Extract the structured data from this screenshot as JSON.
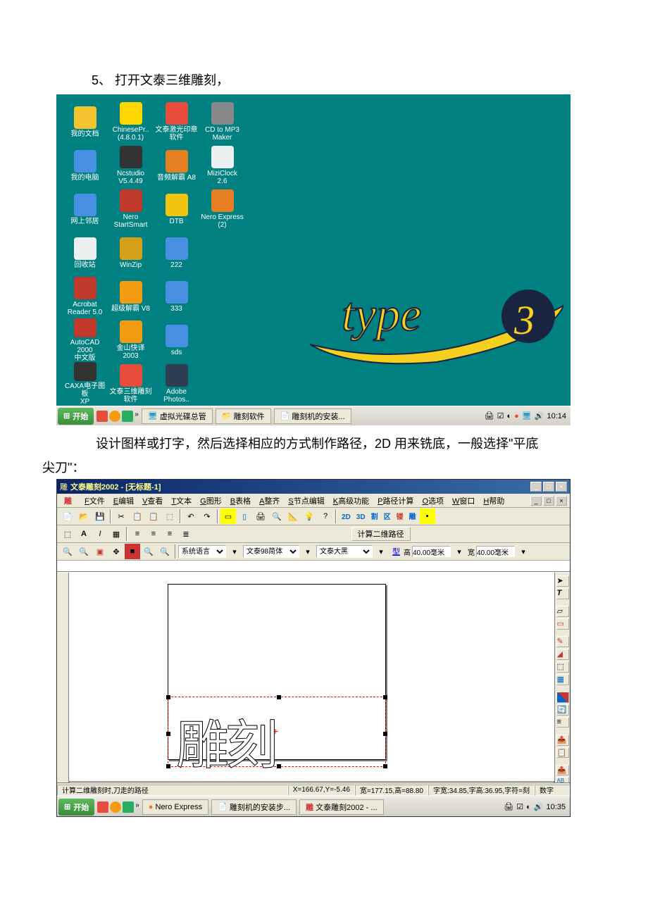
{
  "doc": {
    "step": "5、 打开文泰三维雕刻，",
    "body1": "设计图样或打字，然后选择相应的方式制作路径，2D 用来铣底，一般选择\"平底",
    "body2": "尖刀\"："
  },
  "desktop": {
    "icons": [
      {
        "label": "我的文档",
        "color": "#f4c430"
      },
      {
        "label": "ChinesePr..\n(4.8.0.1)",
        "color": "#ffd700"
      },
      {
        "label": "文泰激光印章\n软件",
        "color": "#e74c3c"
      },
      {
        "label": "CD to MP3\nMaker",
        "color": "#888"
      },
      {
        "label": "",
        "color": "transparent"
      },
      {
        "label": "我的电脑",
        "color": "#4a90e2"
      },
      {
        "label": "Ncstudio\nV5.4.49",
        "color": "#333"
      },
      {
        "label": "音频解霸 A8",
        "color": "#e67e22"
      },
      {
        "label": "MiziClock\n2.6",
        "color": "#ecf0f1"
      },
      {
        "label": "",
        "color": "transparent"
      },
      {
        "label": "网上邻居",
        "color": "#4a90e2"
      },
      {
        "label": "Nero\nStartSmart",
        "color": "#c0392b"
      },
      {
        "label": "DTB",
        "color": "#f1c40f"
      },
      {
        "label": "Nero Express\n(2)",
        "color": "#e67e22"
      },
      {
        "label": "",
        "color": "transparent"
      },
      {
        "label": "回收站",
        "color": "#ecf0f1"
      },
      {
        "label": "WinZip",
        "color": "#d4a017"
      },
      {
        "label": "222",
        "color": "#4a90e2"
      },
      {
        "label": "",
        "color": "transparent"
      },
      {
        "label": "",
        "color": "transparent"
      },
      {
        "label": "Acrobat\nReader 5.0",
        "color": "#c0392b"
      },
      {
        "label": "超级解霸 V8",
        "color": "#f39c12"
      },
      {
        "label": "333",
        "color": "#4a90e2"
      },
      {
        "label": "",
        "color": "transparent"
      },
      {
        "label": "",
        "color": "transparent"
      },
      {
        "label": "AutoCAD 2000\n中文版",
        "color": "#c0392b"
      },
      {
        "label": "金山快译\n2003",
        "color": "#f39c12"
      },
      {
        "label": "sds",
        "color": "#4a90e2"
      },
      {
        "label": "",
        "color": "transparent"
      },
      {
        "label": "",
        "color": "transparent"
      },
      {
        "label": "CAXA电子图板\nXP",
        "color": "#333"
      },
      {
        "label": "文泰三维雕刻\n软件",
        "color": "#e74c3c"
      },
      {
        "label": "Adobe\nPhotos..",
        "color": "#2c3e50"
      }
    ],
    "taskbar": {
      "start": "开始",
      "item1": "虚拟光碟总管",
      "item2": "雕刻软件",
      "item3": "雕刻机的安装...",
      "clock": "10:14"
    }
  },
  "app": {
    "title": "文泰雕刻2002 - [无标题-1]",
    "menu": [
      "F文件",
      "E编辑",
      "V查看",
      "T文本",
      "G图形",
      "B表格",
      "A整齐",
      "S节点编辑",
      "K高级功能",
      "P路径计算",
      "O选项",
      "W窗口",
      "H帮助"
    ],
    "toolbar3d": [
      "2D",
      "3D",
      "割",
      "区",
      "镂",
      "雕"
    ],
    "calc2d": "计算二维路径",
    "lang": "系统语言",
    "font1": "文泰98简体",
    "font2": "文泰大黑",
    "type": "型",
    "h_label": "高",
    "h_val": "40.00毫米",
    "w_label": "宽",
    "w_val": "40.00毫米",
    "engraving_text": "雕刻",
    "status_hint": "计算二维雕刻时,刀走的路径",
    "status_coord": "X=166.67,Y=-5.46",
    "status_size": "宽=177.15,高=88.80",
    "status_font": "字宽:34.85,字高:36.95,字符=刻",
    "status_num": "数字",
    "taskbar": {
      "start": "开始",
      "item1": "Nero Express",
      "item2": "雕刻机的安装步...",
      "item3": "文泰雕刻2002 - ...",
      "clock": "10:35"
    }
  }
}
